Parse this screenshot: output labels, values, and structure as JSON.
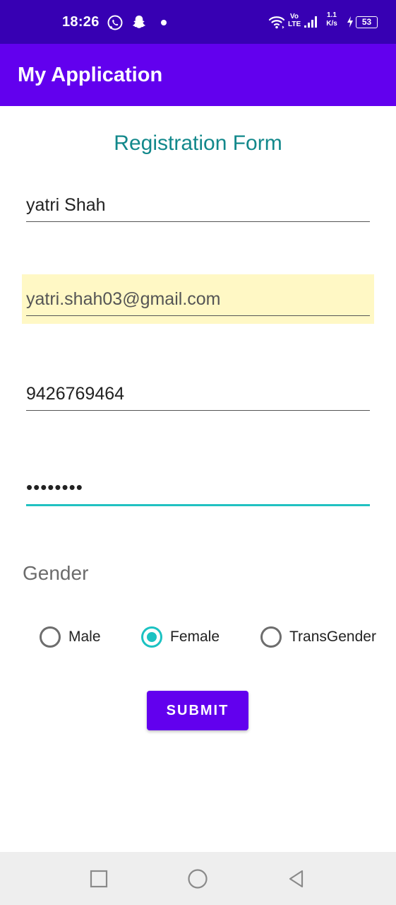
{
  "status_bar": {
    "time": "18:26",
    "network_label_top": "Vo",
    "network_label_bottom": "LTE",
    "speed_value": "1.1",
    "speed_unit": "K/s",
    "battery_level": "53",
    "background": "#3700b3"
  },
  "app_bar": {
    "title": "My Application",
    "background": "#6200ee"
  },
  "form": {
    "title": "Registration Form",
    "name_value": "yatri Shah",
    "email_value": "yatri.shah03@gmail.com",
    "phone_value": "9426769464",
    "password_value": "••••••••",
    "gender_label": "Gender",
    "gender_options": [
      {
        "label": "Male",
        "checked": false
      },
      {
        "label": "Female",
        "checked": true
      },
      {
        "label": "TransGender",
        "checked": false
      }
    ],
    "submit_label": "SUBMIT",
    "accent_color": "#1bc2c2",
    "title_color": "#12888b"
  },
  "nav_bar": {
    "icons": [
      "recents-icon",
      "home-icon",
      "back-icon"
    ]
  }
}
